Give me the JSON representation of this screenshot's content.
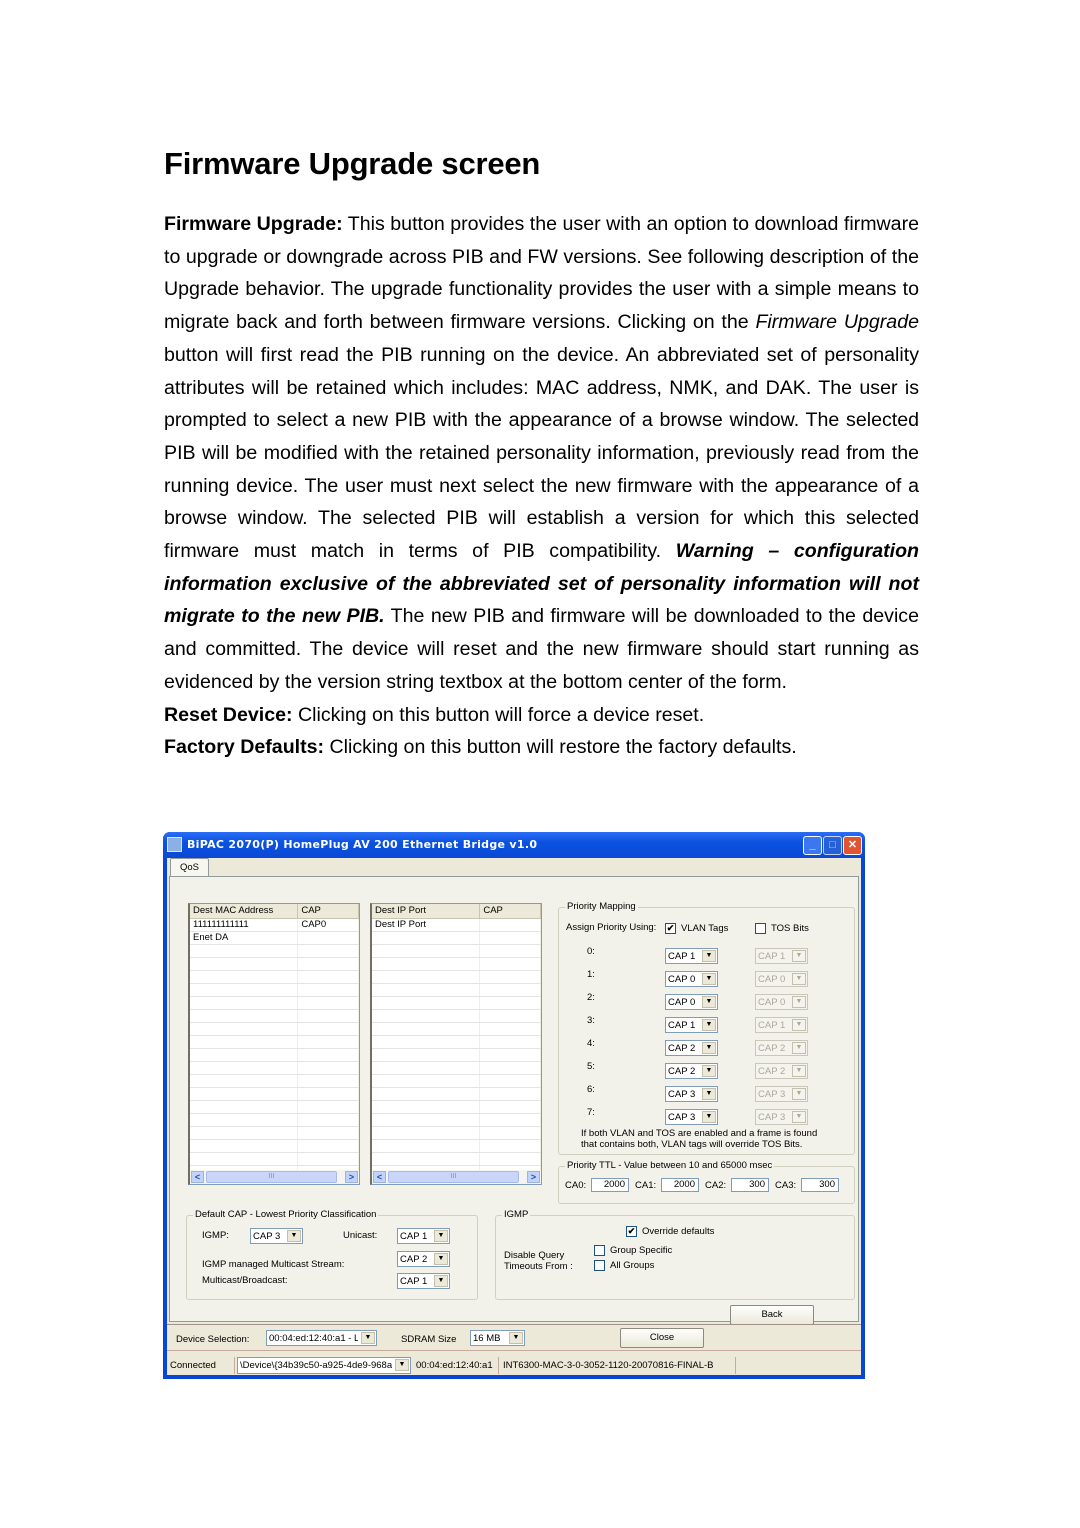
{
  "document": {
    "title": "Firmware Upgrade screen",
    "paragraphs": {
      "p1_lead": "Firmware Upgrade:",
      "p1_a": " This button provides the user with an option to download firmware to upgrade or downgrade across PIB and FW versions. See following description of the Upgrade behavior. The upgrade functionality provides the user with a simple means to migrate back and forth between firmware versions. Clicking on the ",
      "p1_italic": "Firmware Upgrade",
      "p1_b": " button will first read the PIB running on the device. An abbreviated set of personality attributes will be retained which includes: MAC address, NMK, and DAK. The user is prompted to select a new PIB with the appearance of a browse window. The selected PIB will be modified with the retained personality information, previously read from the running device. The user must next select the new firmware with the appearance of a browse window. The selected PIB will establish a version for which this selected firmware must match in terms of PIB compatibility. ",
      "p1_warning": "Warning – configuration information exclusive of the abbreviated set of personality information will not migrate to the new PIB.",
      "p1_c": " The new PIB and firmware will be downloaded to the device and committed. The device will reset and the new firmware should start running as evidenced by the version string textbox at the bottom center of the form.",
      "p2_lead": "Reset Device:",
      "p2_text": " Clicking on this button will force a device reset.",
      "p3_lead": "Factory Defaults:",
      "p3_text": " Clicking on this button will restore the factory defaults."
    }
  },
  "window": {
    "title": "BiPAC 2070(P) HomePlug AV 200 Ethernet Bridge v1.0",
    "controls": {
      "minimize": "_",
      "maximize": "□",
      "close": "✕"
    },
    "tab": "QoS",
    "mac_list": {
      "headers": [
        "Dest MAC Address",
        "CAP"
      ],
      "rows": [
        [
          "111111111111",
          "CAP0"
        ],
        [
          "Enet DA",
          ""
        ]
      ]
    },
    "ip_list": {
      "headers": [
        "Dest IP Port",
        "CAP"
      ],
      "rows": [
        [
          "Dest IP Port",
          ""
        ]
      ]
    },
    "scroll": {
      "left": "<",
      "right": ">",
      "thumb": "III"
    },
    "priority_mapping": {
      "label": "Priority Mapping",
      "assign_label": "Assign Priority Using:",
      "vlan_label": "VLAN Tags",
      "vlan_checked": true,
      "tos_label": "TOS Bits",
      "tos_checked": false,
      "rows": [
        {
          "label": "0:",
          "vlan": "CAP 1",
          "tos": "CAP 1"
        },
        {
          "label": "1:",
          "vlan": "CAP 0",
          "tos": "CAP 0"
        },
        {
          "label": "2:",
          "vlan": "CAP 0",
          "tos": "CAP 0"
        },
        {
          "label": "3:",
          "vlan": "CAP 1",
          "tos": "CAP 1"
        },
        {
          "label": "4:",
          "vlan": "CAP 2",
          "tos": "CAP 2"
        },
        {
          "label": "5:",
          "vlan": "CAP 2",
          "tos": "CAP 2"
        },
        {
          "label": "6:",
          "vlan": "CAP 3",
          "tos": "CAP 3"
        },
        {
          "label": "7:",
          "vlan": "CAP 3",
          "tos": "CAP 3"
        }
      ],
      "note_line1": "If both VLAN and TOS are enabled and a frame is found",
      "note_line2": "that contains both, VLAN tags will override TOS Bits."
    },
    "priority_ttl": {
      "label": "Priority TTL - Value between 10 and 65000 msec",
      "fields": [
        {
          "label": "CA0:",
          "value": "2000"
        },
        {
          "label": "CA1:",
          "value": "2000"
        },
        {
          "label": "CA2:",
          "value": "300"
        },
        {
          "label": "CA3:",
          "value": "300"
        }
      ]
    },
    "default_cap": {
      "label": "Default CAP - Lowest Priority Classification",
      "igmp_label": "IGMP:",
      "igmp_value": "CAP 3",
      "unicast_label": "Unicast:",
      "unicast_value": "CAP 1",
      "igmp_stream_label": "IGMP managed Multicast Stream:",
      "igmp_stream_value": "CAP 2",
      "multicast_label": "Multicast/Broadcast:",
      "multicast_value": "CAP 1"
    },
    "igmp": {
      "label": "IGMP",
      "override_label": "Override defaults",
      "override_checked": true,
      "disable_label_1": "Disable Query",
      "disable_label_2": "Timeouts From :",
      "group_specific_label": "Group Specific",
      "group_specific_checked": false,
      "all_groups_label": "All Groups",
      "all_groups_checked": false
    },
    "back_button": "Back",
    "device_selection_label": "Device Selection:",
    "device_selection_value": "00:04:ed:12:40:a1 - L",
    "sdram_label": "SDRAM Size",
    "sdram_value": "16 MB",
    "close_button": "Close",
    "status_bar": {
      "state": "Connected",
      "adapter": "\\Device\\{34b39c50-a925-4de9-968a",
      "mac": "00:04:ed:12:40:a1",
      "version": "INT6300-MAC-3-0-3052-1120-20070816-FINAL-B",
      "extra": ""
    },
    "dropdown_arrow": "▼",
    "check_mark": "✔"
  }
}
